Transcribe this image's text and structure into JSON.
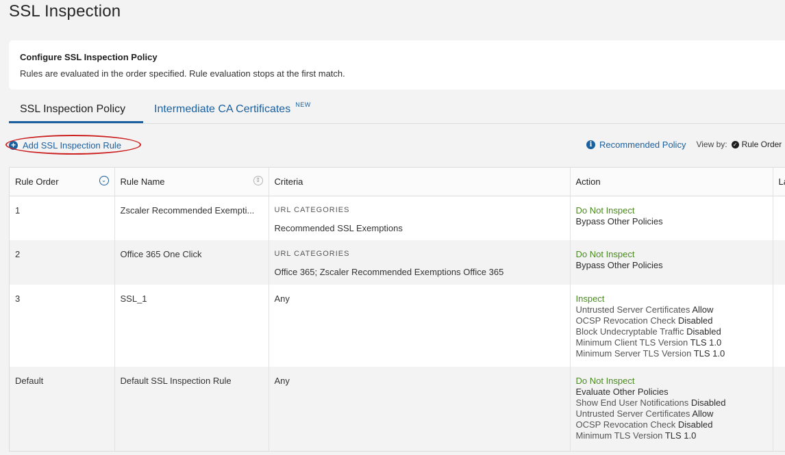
{
  "page": {
    "title": "SSL Inspection"
  },
  "config": {
    "title": "Configure SSL Inspection Policy",
    "description": "Rules are evaluated in the order specified. Rule evaluation stops at the first match."
  },
  "tabs": [
    {
      "label": "SSL Inspection Policy",
      "active": true
    },
    {
      "label": "Intermediate CA Certificates",
      "badge": "NEW",
      "active": false
    }
  ],
  "toolbar": {
    "add_rule_label": "Add SSL Inspection Rule",
    "recommended_label": "Recommended Policy",
    "view_by_label": "View by:",
    "view_by_value": "Rule Order"
  },
  "table": {
    "headers": {
      "order": "Rule Order",
      "name": "Rule Name",
      "criteria": "Criteria",
      "action": "Action",
      "last": "La"
    },
    "rows": [
      {
        "order": "1",
        "name": "Zscaler Recommended Exempti...",
        "criteria_label": "URL CATEGORIES",
        "criteria_value": "Recommended SSL Exemptions",
        "action_primary": "Do Not Inspect",
        "action_secondary": "Bypass Other Policies"
      },
      {
        "order": "2",
        "name": "Office 365 One Click",
        "criteria_label": "URL CATEGORIES",
        "criteria_value": "Office 365; Zscaler Recommended Exemptions Office 365",
        "action_primary": "Do Not Inspect",
        "action_secondary": "Bypass Other Policies"
      },
      {
        "order": "3",
        "name": "SSL_1",
        "criteria_value": "Any",
        "action_primary": "Inspect",
        "details": [
          {
            "label": "Untrusted Server Certificates",
            "value": "Allow"
          },
          {
            "label": "OCSP Revocation Check",
            "value": "Disabled"
          },
          {
            "label": "Block Undecryptable Traffic",
            "value": "Disabled"
          },
          {
            "label": "Minimum Client TLS Version",
            "value": "TLS 1.0"
          },
          {
            "label": "Minimum Server TLS Version",
            "value": "TLS 1.0"
          }
        ]
      },
      {
        "order": "Default",
        "name": "Default SSL Inspection Rule",
        "criteria_value": "Any",
        "action_primary": "Do Not Inspect",
        "action_secondary": "Evaluate Other Policies",
        "details": [
          {
            "label": "Show End User Notifications",
            "value": "Disabled"
          },
          {
            "label": "Untrusted Server Certificates",
            "value": "Allow"
          },
          {
            "label": "OCSP Revocation Check",
            "value": "Disabled"
          },
          {
            "label": "Minimum TLS Version",
            "value": "TLS 1.0"
          }
        ]
      }
    ]
  },
  "colors": {
    "accent": "#1a5f9e",
    "action_green": "#4a8a1f",
    "annotation_red": "#cc2222"
  },
  "icons": {
    "add": "plus-circle-icon",
    "info": "info-icon",
    "check": "check-circle-icon",
    "sort": "sort-circle-icon"
  }
}
